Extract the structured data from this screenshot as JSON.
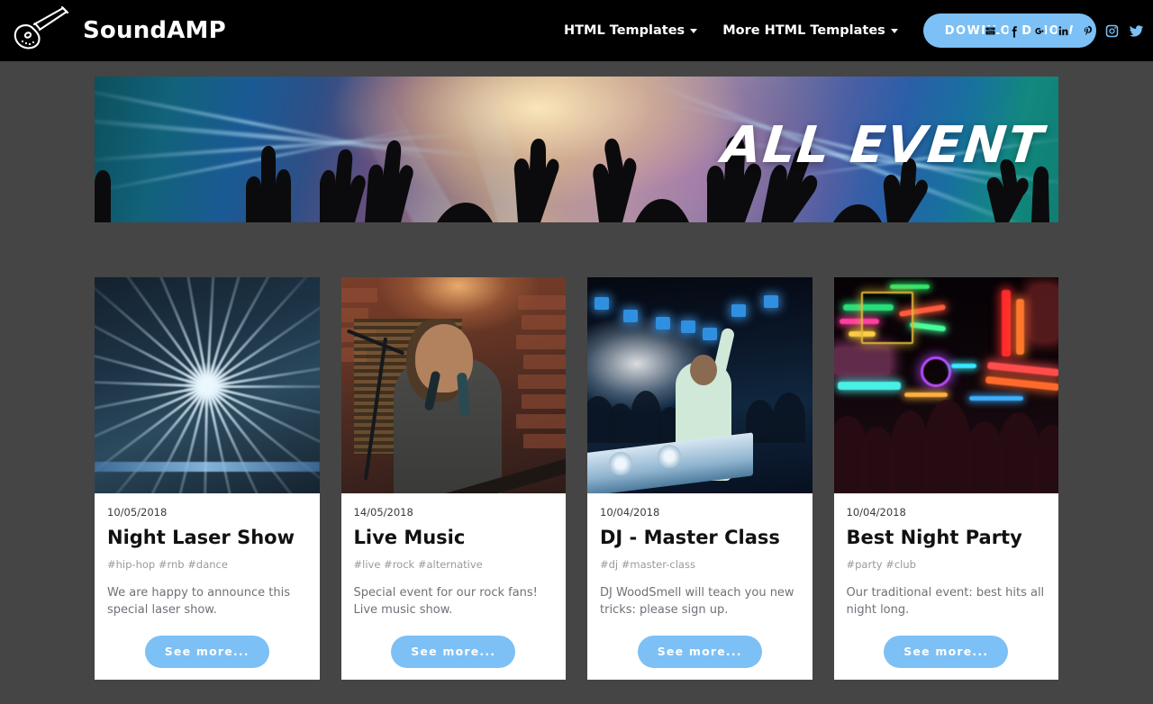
{
  "header": {
    "brand_name": "SoundAMP",
    "logo_icon": "guitar-icon",
    "nav": [
      {
        "label": "HTML Templates",
        "has_caret": true
      },
      {
        "label": "More HTML Templates",
        "has_caret": true
      }
    ],
    "download_label": "DOWNLOAD NOW",
    "social": [
      {
        "name": "youtube-icon"
      },
      {
        "name": "facebook-icon"
      },
      {
        "name": "googleplus-icon"
      },
      {
        "name": "linkedin-icon"
      },
      {
        "name": "pinterest-icon"
      },
      {
        "name": "instagram-icon"
      },
      {
        "name": "twitter-icon"
      }
    ]
  },
  "hero": {
    "title": "ALL EVENT"
  },
  "cards": [
    {
      "date": "10/05/2018",
      "title": "Night Laser Show",
      "tags": "#hip-hop #rnb #dance",
      "description": "We are happy to announce this special laser show.",
      "button_label": "See more...",
      "image_name": "laser-show-photo"
    },
    {
      "date": "14/05/2018",
      "title": "Live Music",
      "tags": "#live #rock #alternative",
      "description": "Special event for our rock fans! Live music show.",
      "button_label": "See more...",
      "image_name": "live-music-photo"
    },
    {
      "date": "10/04/2018",
      "title": "DJ - Master Class",
      "tags": "#dj #master-class",
      "description": "DJ WoodSmell will teach you new tricks: please sign up.",
      "button_label": "See more...",
      "image_name": "dj-crowd-photo"
    },
    {
      "date": "10/04/2018",
      "title": "Best Night Party",
      "tags": "#party #club",
      "description": "Our traditional event: best hits all night long.",
      "button_label": "See more...",
      "image_name": "neon-street-photo"
    }
  ],
  "colors": {
    "accent_blue": "#7CC0F5",
    "page_background": "#454545",
    "header_background": "#000000",
    "card_background": "#ffffff"
  }
}
